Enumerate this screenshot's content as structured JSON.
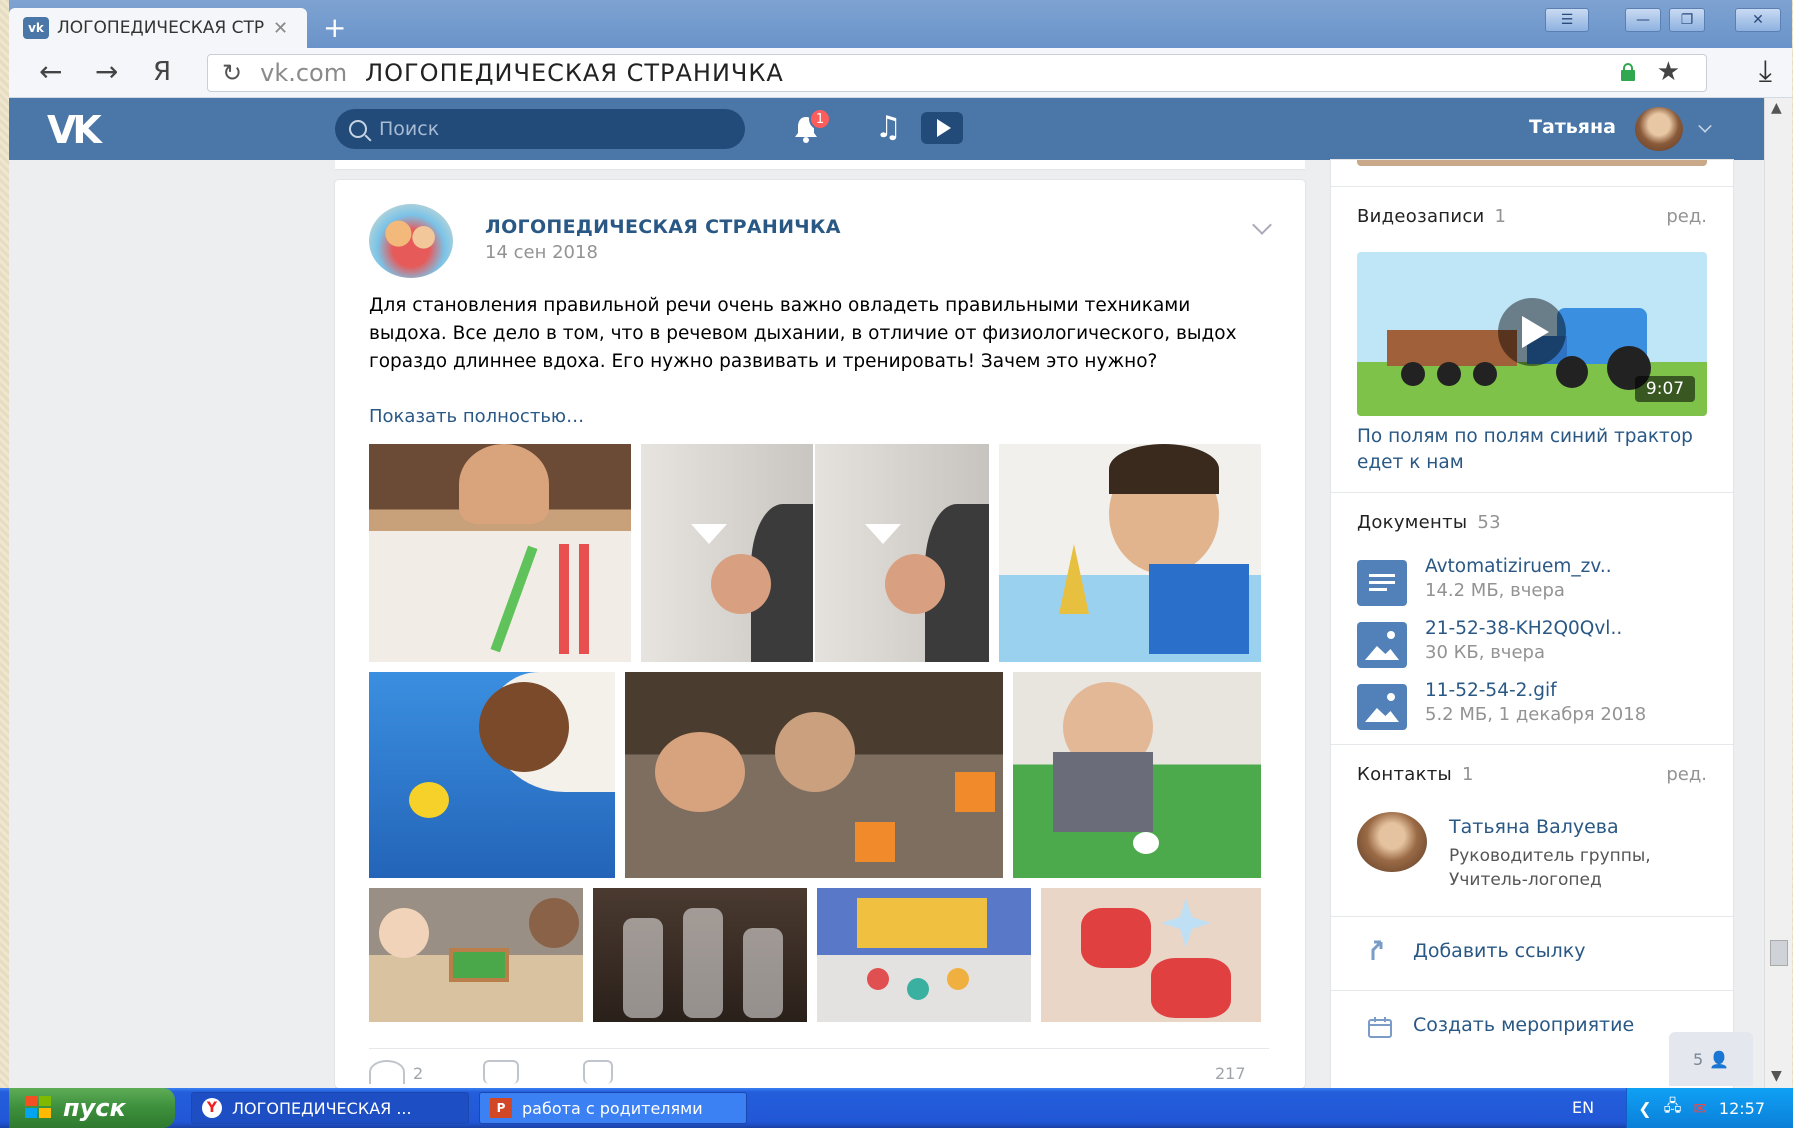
{
  "browser": {
    "tab_title": "ЛОГОПЕДИЧЕСКАЯ СТР",
    "tab_favicon": "vk",
    "url_host": "vk.com",
    "url_title": "ЛОГОПЕДИЧЕСКАЯ СТРАНИЧКА",
    "yandex_button": "Я"
  },
  "vk_header": {
    "logo": "VK",
    "search_placeholder": "Поиск",
    "notifications_count": "1",
    "user_name": "Татьяна"
  },
  "post": {
    "author": "ЛОГОПЕДИЧЕСКАЯ СТРАНИЧКА",
    "date": "14 сен 2018",
    "text": "Для становления правильной речи очень важно овладеть правильными техниками выдоха. Все дело в том, что в речевом дыхании, в отличие от физиологического, выдох гораздо длиннее вдоха. Его нужно развивать и тренировать! Зачем это нужно?",
    "show_more": "Показать полностью…",
    "likes": "2",
    "views": "217"
  },
  "sidebar": {
    "videos": {
      "title": "Видеозаписи",
      "count": "1",
      "edit": "ред.",
      "video_title": "По полям по полям синий трактор едет к нам",
      "duration": "9:07"
    },
    "documents": {
      "title": "Документы",
      "count": "53",
      "items": [
        {
          "name": "Avtomatiziruem_zv..",
          "meta": "14.2 МБ, вчера",
          "icon": "text-doc-icon"
        },
        {
          "name": "21-52-38-KH2Q0Qvl..",
          "meta": "30 КБ, вчера",
          "icon": "image-doc-icon"
        },
        {
          "name": "11-52-54-2.gif",
          "meta": "5.2 МБ, 1 декабря 2018",
          "icon": "image-doc-icon"
        }
      ]
    },
    "contacts": {
      "title": "Контакты",
      "count": "1",
      "edit": "ред.",
      "name": "Татьяна Валуева",
      "role": "Руководитель группы, Учитель-логопед"
    },
    "add_link": "Добавить ссылку",
    "create_event": "Создать мероприятие"
  },
  "online_count": "5",
  "taskbar": {
    "start": "пуск",
    "tasks": [
      {
        "label": "ЛОГОПЕДИЧЕСКАЯ ..."
      },
      {
        "label": "работа с родителями"
      }
    ],
    "lang": "EN",
    "clock": "12:57"
  }
}
